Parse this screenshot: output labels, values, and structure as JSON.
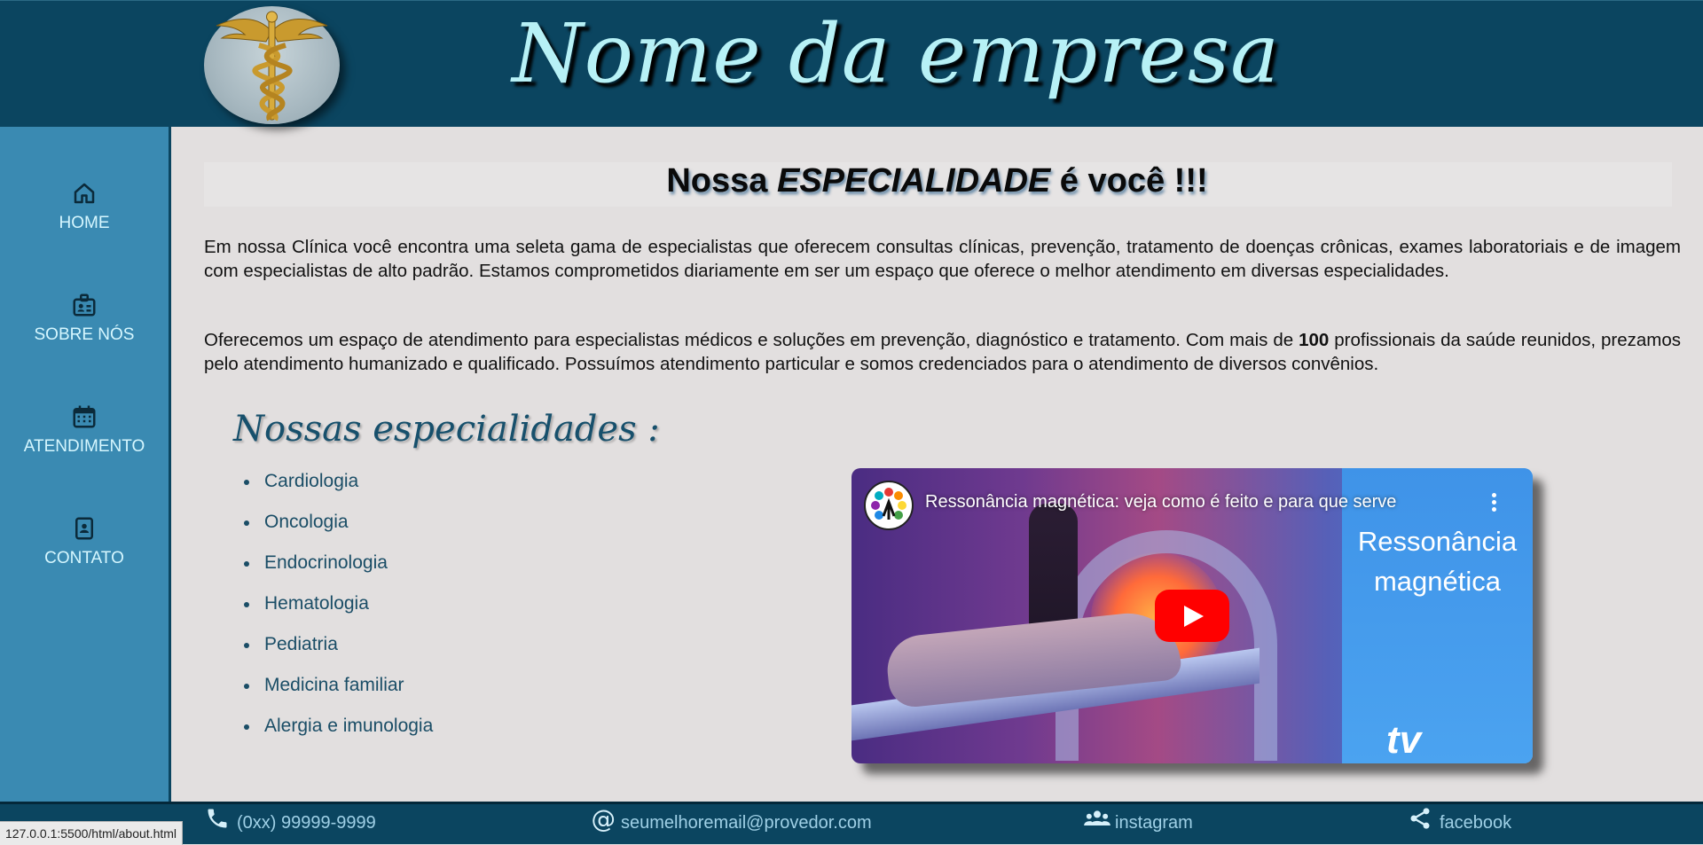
{
  "header": {
    "company_name": "Nome da empresa"
  },
  "sidebar": {
    "items": [
      {
        "label": "HOME",
        "icon": "home-icon"
      },
      {
        "label": "SOBRE NÓS",
        "icon": "id-badge-icon"
      },
      {
        "label": "ATENDIMENTO",
        "icon": "calendar-icon"
      },
      {
        "label": "CONTATO",
        "icon": "contact-file-icon"
      }
    ]
  },
  "main": {
    "headline_prefix": "Nossa ",
    "headline_emphasis": "ESPECIALIDADE",
    "headline_suffix": " é você !!!",
    "paragraph1": "Em nossa Clínica você encontra uma seleta gama de especialistas que oferecem consultas clínicas, prevenção, tratamento de doenças crônicas, exames laboratoriais e de imagem com especialistas de alto padrão. Estamos comprometidos diariamente em ser um espaço que oferece o melhor atendimento em diversas especialidades.",
    "paragraph2_start": "Oferecemos um espaço de atendimento para especialistas médicos e soluções em prevenção, diagnóstico e tratamento. Com mais de ",
    "paragraph2_bold": "100",
    "paragraph2_end": " profissionais da saúde reunidos, prezamos pelo atendimento humanizado e qualificado. Possuímos atendimento particular e somos credenciados para o atendimento de diversos convênios.",
    "section_title": "Nossas especialidades :",
    "specialties": [
      "Cardiologia",
      "Oncologia",
      "Endocrinologia",
      "Hematologia",
      "Pediatria",
      "Medicina familiar",
      "Alergia e imunologia"
    ]
  },
  "video": {
    "title": "Ressonância magnética: veja como é feito e para que serve",
    "overlay_line1": "Ressonância",
    "overlay_line2": "magnética",
    "channel_logo_text": "tv"
  },
  "footer": {
    "phone": "(0xx) 99999-9999",
    "email": "seumelhoremail@provedor.com",
    "instagram": "instagram",
    "facebook": "facebook"
  },
  "status_bar": {
    "url": "127.0.0.1:5500/html/about.html"
  },
  "colors": {
    "header_bg": "#0b4560",
    "sidebar_bg": "#3a8ab2",
    "content_bg": "#e2dfdf",
    "title_color": "#b7f1f6",
    "youtube_red": "#ff0000"
  }
}
